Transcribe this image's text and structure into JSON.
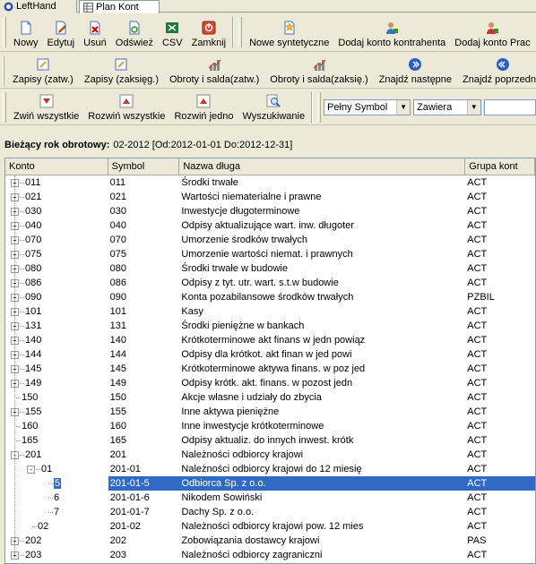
{
  "tabs": [
    {
      "label": "LeftHand",
      "icon": "lefthand-logo-icon"
    },
    {
      "label": "Plan Kont",
      "icon": "grid-icon"
    }
  ],
  "toolbar1": [
    {
      "label": "Nowy",
      "icon": "new-document-icon"
    },
    {
      "label": "Edytuj",
      "icon": "edit-icon"
    },
    {
      "label": "Usuń",
      "icon": "delete-icon"
    },
    {
      "label": "Odśwież",
      "icon": "refresh-icon"
    },
    {
      "label": "CSV",
      "icon": "csv-icon"
    },
    {
      "label": "Zamknij",
      "icon": "close-icon"
    },
    {
      "label": "Nowe syntetyczne",
      "icon": "new-synthetic-icon"
    },
    {
      "label": "Dodaj konto kontrahenta",
      "icon": "add-contractor-account-icon"
    },
    {
      "label": "Dodaj konto Prac",
      "icon": "add-employee-account-icon"
    }
  ],
  "toolbar2": [
    {
      "label": "Zapisy (zatw.)",
      "icon": "entries-icon"
    },
    {
      "label": "Zapisy (zaksięg.)",
      "icon": "entries-posted-icon"
    },
    {
      "label": "Obroty i salda(zatw.)",
      "icon": "turnover-icon"
    },
    {
      "label": "Obroty i salda(zaksię.)",
      "icon": "turnover-posted-icon"
    },
    {
      "label": "Znajdź następne",
      "icon": "find-next-icon"
    },
    {
      "label": "Znajdź poprzednie",
      "icon": "find-previous-icon"
    }
  ],
  "toolbar3": [
    {
      "label": "Zwiń wszystkie",
      "icon": "collapse-all-icon"
    },
    {
      "label": "Rozwiń wszystkie",
      "icon": "expand-all-icon"
    },
    {
      "label": "Rozwiń jedno",
      "icon": "expand-one-icon"
    },
    {
      "label": "Wyszukiwanie",
      "icon": "search-icon"
    }
  ],
  "search": {
    "field": "Pełny Symbol",
    "mode": "Zawiera",
    "value": ""
  },
  "year": {
    "label": "Bieżący rok obrotowy:",
    "value": "02-2012 [Od:2012-01-01 Do:2012-12-31]"
  },
  "columns": [
    "Konto",
    "Symbol",
    "Nazwa długa",
    "Grupa kont"
  ],
  "rows": [
    {
      "konto": "011",
      "symbol": "011",
      "nazwa": "Środki trwałe",
      "grupa": "ACT",
      "level": 0,
      "expander": "+"
    },
    {
      "konto": "021",
      "symbol": "021",
      "nazwa": "Wartości niematerialne i prawne",
      "grupa": "ACT",
      "level": 0,
      "expander": "+"
    },
    {
      "konto": "030",
      "symbol": "030",
      "nazwa": "Inwestycje długoterminowe",
      "grupa": "ACT",
      "level": 0,
      "expander": "+"
    },
    {
      "konto": "040",
      "symbol": "040",
      "nazwa": "Odpisy aktualizujące wart. inw. długoter",
      "grupa": "ACT",
      "level": 0,
      "expander": "+"
    },
    {
      "konto": "070",
      "symbol": "070",
      "nazwa": "Umorzenie środków trwałych",
      "grupa": "ACT",
      "level": 0,
      "expander": "+"
    },
    {
      "konto": "075",
      "symbol": "075",
      "nazwa": "Umorzenie wartości niemat. i prawnych",
      "grupa": "ACT",
      "level": 0,
      "expander": "+"
    },
    {
      "konto": "080",
      "symbol": "080",
      "nazwa": "Środki trwałe w budowie",
      "grupa": "ACT",
      "level": 0,
      "expander": "+"
    },
    {
      "konto": "086",
      "symbol": "086",
      "nazwa": "Odpisy z tyt. utr. wart. s.t.w budowie",
      "grupa": "ACT",
      "level": 0,
      "expander": "+"
    },
    {
      "konto": "090",
      "symbol": "090",
      "nazwa": "Konta pozabilansowe środków trwałych",
      "grupa": "PZBIL",
      "level": 0,
      "expander": "+"
    },
    {
      "konto": "101",
      "symbol": "101",
      "nazwa": "Kasy",
      "grupa": "ACT",
      "level": 0,
      "expander": "+"
    },
    {
      "konto": "131",
      "symbol": "131",
      "nazwa": "Środki pieniężne w bankach",
      "grupa": "ACT",
      "level": 0,
      "expander": "+"
    },
    {
      "konto": "140",
      "symbol": "140",
      "nazwa": "Krótkoterminowe akt finans w jedn powiąz",
      "grupa": "ACT",
      "level": 0,
      "expander": "+"
    },
    {
      "konto": "144",
      "symbol": "144",
      "nazwa": "Odpisy dla krótkot. akt finan w jed powi",
      "grupa": "ACT",
      "level": 0,
      "expander": "+"
    },
    {
      "konto": "145",
      "symbol": "145",
      "nazwa": "Krótkoterminowe aktywa finans. w poz jed",
      "grupa": "ACT",
      "level": 0,
      "expander": "+"
    },
    {
      "konto": "149",
      "symbol": "149",
      "nazwa": "Odpisy krótk. akt. finans. w pozost jedn",
      "grupa": "ACT",
      "level": 0,
      "expander": "+"
    },
    {
      "konto": "150",
      "symbol": "150",
      "nazwa": "Akcje własne i udziały do zbycia",
      "grupa": "ACT",
      "level": 0,
      "expander": ""
    },
    {
      "konto": "155",
      "symbol": "155",
      "nazwa": "Inne aktywa pieniężne",
      "grupa": "ACT",
      "level": 0,
      "expander": "+"
    },
    {
      "konto": "160",
      "symbol": "160",
      "nazwa": "Inne inwestycje krótkoterminowe",
      "grupa": "ACT",
      "level": 0,
      "expander": ""
    },
    {
      "konto": "165",
      "symbol": "165",
      "nazwa": "Odpisy aktualiz. do innych inwest. krótk",
      "grupa": "ACT",
      "level": 0,
      "expander": ""
    },
    {
      "konto": "201",
      "symbol": "201",
      "nazwa": "Należności odbiorcy krajowi",
      "grupa": "ACT",
      "level": 0,
      "expander": "-"
    },
    {
      "konto": "01",
      "symbol": "201-01",
      "nazwa": "Należności odbiorcy krajowi do 12 miesię",
      "grupa": "ACT",
      "level": 1,
      "expander": "-"
    },
    {
      "konto": "5",
      "symbol": "201-01-5",
      "nazwa": "Odbiorca Sp. z o.o.",
      "grupa": "ACT",
      "level": 2,
      "expander": "",
      "selected": true
    },
    {
      "konto": "6",
      "symbol": "201-01-6",
      "nazwa": "Nikodem Sowiński",
      "grupa": "ACT",
      "level": 2,
      "expander": ""
    },
    {
      "konto": "7",
      "symbol": "201-01-7",
      "nazwa": "Dachy Sp. z o.o.",
      "grupa": "ACT",
      "level": 2,
      "expander": ""
    },
    {
      "konto": "02",
      "symbol": "201-02",
      "nazwa": "Należności odbiorcy krajowi pow. 12 mies",
      "grupa": "ACT",
      "level": 1,
      "expander": ""
    },
    {
      "konto": "202",
      "symbol": "202",
      "nazwa": "Zobowiązania dostawcy krajowi",
      "grupa": "PAS",
      "level": 0,
      "expander": "+"
    },
    {
      "konto": "203",
      "symbol": "203",
      "nazwa": "Należności odbiorcy zagraniczni",
      "grupa": "ACT",
      "level": 0,
      "expander": "+"
    }
  ]
}
